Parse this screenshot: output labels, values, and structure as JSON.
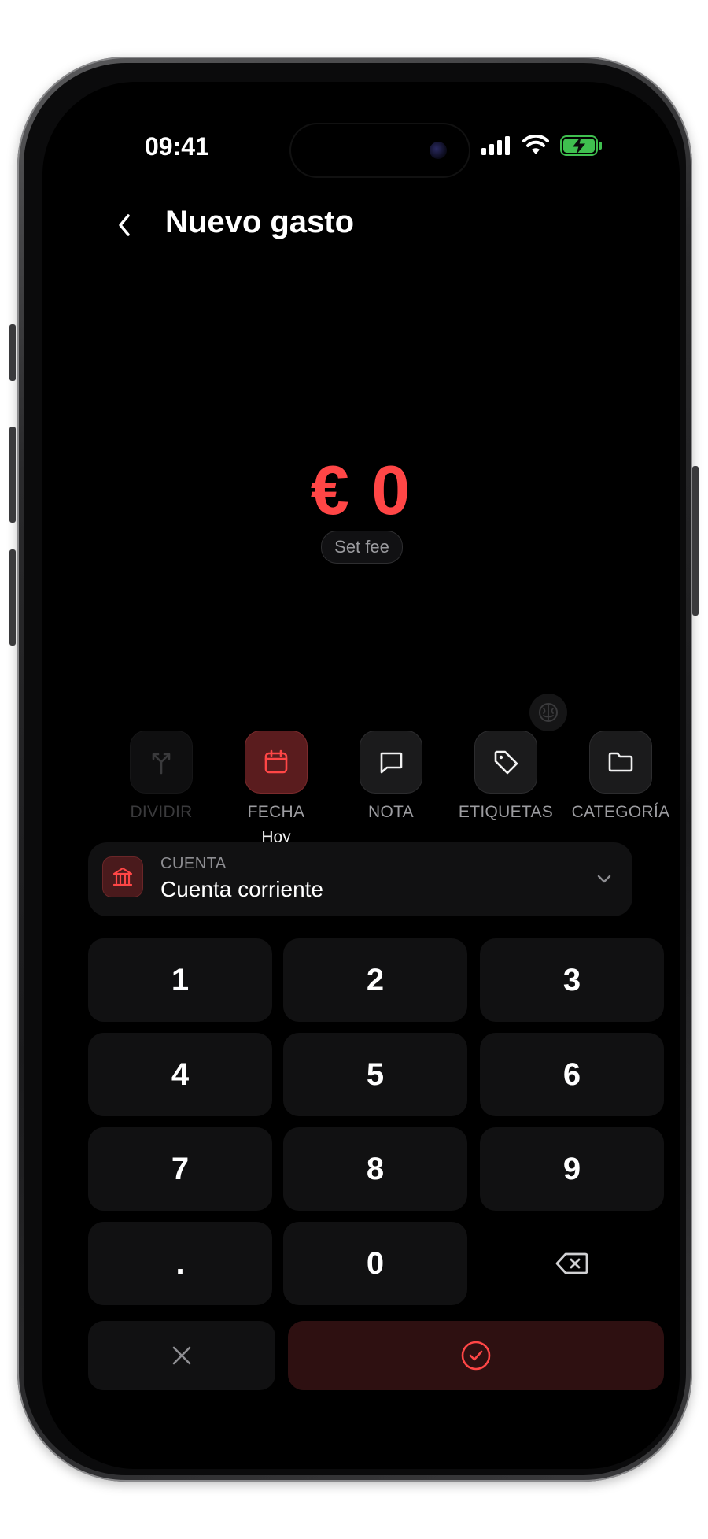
{
  "status_bar": {
    "time": "09:41",
    "icons": [
      "signal-icon",
      "wifi-icon",
      "battery-charging-icon"
    ]
  },
  "header": {
    "title": "Nuevo gasto",
    "back_icon": "chevron-left-icon"
  },
  "amount": {
    "display": "€ 0",
    "fee_chip": "Set fee"
  },
  "actions": [
    {
      "label": "DIVIDIR",
      "icon": "split-icon",
      "state": "disabled",
      "sub": ""
    },
    {
      "label": "FECHA",
      "icon": "calendar-icon",
      "state": "active",
      "sub": "Hoy"
    },
    {
      "label": "NOTA",
      "icon": "message-icon",
      "state": "normal",
      "sub": ""
    },
    {
      "label": "ETIQUETAS",
      "icon": "tag-icon",
      "state": "normal",
      "sub": ""
    },
    {
      "label": "CATEGORÍA",
      "icon": "folder-icon",
      "state": "normal",
      "sub": ""
    }
  ],
  "account": {
    "label": "CUENTA",
    "value": "Cuenta corriente",
    "icon": "bank-icon"
  },
  "keypad": {
    "keys": [
      "1",
      "2",
      "3",
      "4",
      "5",
      "6",
      "7",
      "8",
      "9",
      ".",
      "0"
    ],
    "backspace_icon": "backspace-icon",
    "cancel_icon": "close-icon",
    "confirm_icon": "check-circle-icon"
  },
  "colors": {
    "accent": "#ff4646",
    "background": "#000000",
    "surface": "#111112",
    "active_surface": "#5a1c1e"
  }
}
